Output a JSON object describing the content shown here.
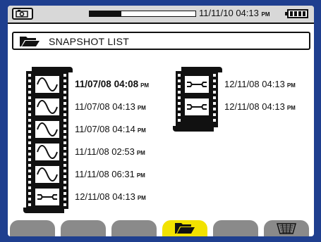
{
  "status": {
    "date": "11/11/10",
    "time": "04:13",
    "ampm": "PM",
    "progress": 0.3,
    "left_icon": "snapshot-camera-icon",
    "battery_icon": "battery-icon"
  },
  "title": {
    "icon": "folder-open-icon",
    "text": "SNAPSHOT LIST"
  },
  "list_left": {
    "icon": "film-strip-icon",
    "entries": [
      {
        "date": "11/07/08",
        "time": "04:08",
        "ampm": "PM",
        "type": "waveform",
        "selected": true
      },
      {
        "date": "11/07/08",
        "time": "04:13",
        "ampm": "PM",
        "type": "waveform",
        "selected": false
      },
      {
        "date": "11/07/08",
        "time": "04:14",
        "ampm": "PM",
        "type": "waveform",
        "selected": false
      },
      {
        "date": "11/11/08",
        "time": "02:53",
        "ampm": "PM",
        "type": "waveform",
        "selected": false
      },
      {
        "date": "11/11/08",
        "time": "06:31",
        "ampm": "PM",
        "type": "waveform",
        "selected": false
      },
      {
        "date": "12/11/08",
        "time": "04:13",
        "ampm": "PM",
        "type": "wrench",
        "selected": false
      }
    ]
  },
  "list_right": {
    "icon": "film-strip-icon",
    "entries": [
      {
        "date": "12/11/08",
        "time": "04:13",
        "ampm": "PM",
        "type": "wrench",
        "selected": false
      },
      {
        "date": "12/11/08",
        "time": "04:13",
        "ampm": "PM",
        "type": "wrench",
        "selected": false
      }
    ]
  },
  "tabs": [
    {
      "icon": "",
      "active": false
    },
    {
      "icon": "",
      "active": false
    },
    {
      "icon": "",
      "active": false
    },
    {
      "icon": "folder-open-icon",
      "active": true
    },
    {
      "icon": "",
      "active": false
    },
    {
      "icon": "trash-icon",
      "active": false
    }
  ],
  "colors": {
    "bezel": "#1f3f8f",
    "tab_inactive": "#8a8a8a",
    "tab_active": "#f2e200"
  }
}
